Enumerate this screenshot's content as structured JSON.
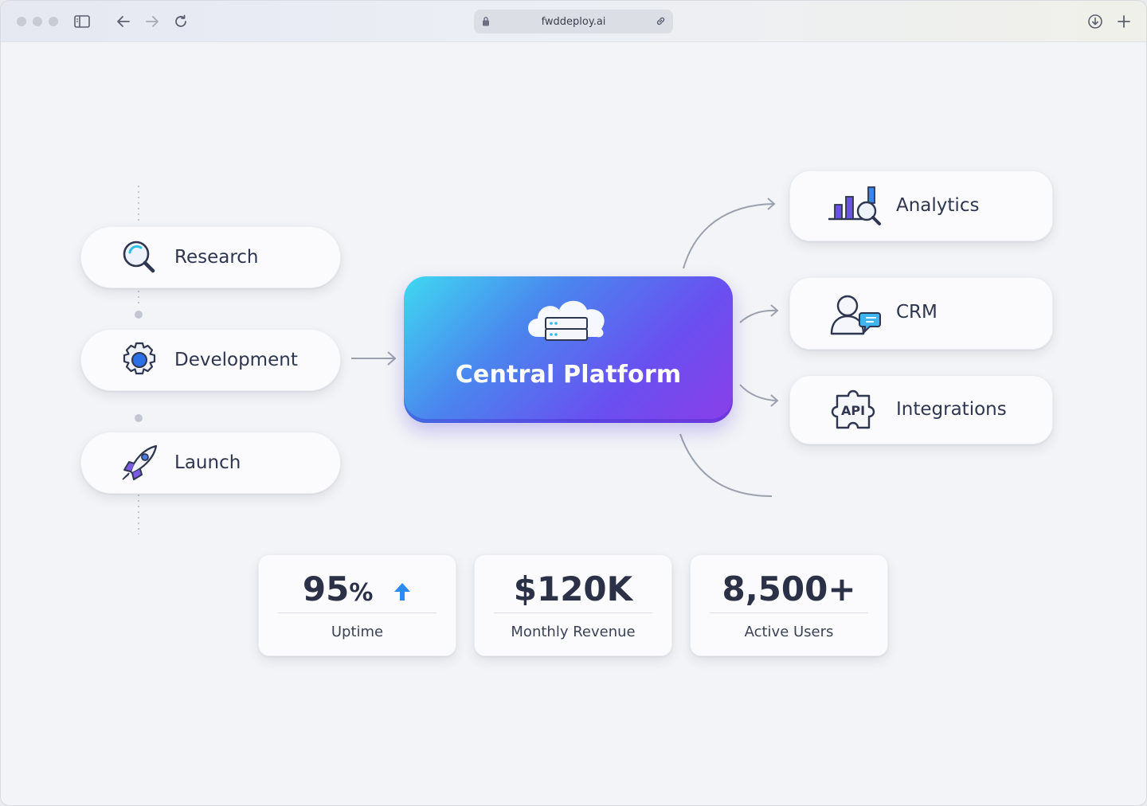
{
  "browser": {
    "url": "fwddeploy.ai"
  },
  "stages": [
    {
      "label": "Research",
      "icon": "magnifier-icon"
    },
    {
      "label": "Development",
      "icon": "gear-icon"
    },
    {
      "label": "Launch",
      "icon": "rocket-icon"
    }
  ],
  "central": {
    "title": "Central Platform",
    "icon": "cloud-server-icon"
  },
  "services": [
    {
      "label": "Analytics",
      "icon": "bar-chart-magnifier-icon"
    },
    {
      "label": "CRM",
      "icon": "user-chat-icon"
    },
    {
      "label": "Integrations",
      "icon": "api-puzzle-icon",
      "icon_text": "API"
    }
  ],
  "stats": [
    {
      "value": "95",
      "unit": "%",
      "label": "Uptime",
      "trend": "up-arrow-icon"
    },
    {
      "value": "$120K",
      "label": "Monthly Revenue"
    },
    {
      "value": "8,500+",
      "label": "Active Users"
    }
  ],
  "colors": {
    "gradient_start": "#3fd9f0",
    "gradient_end": "#8a3fe8",
    "text_dark": "#2b3247",
    "accent_blue": "#2a8bf2"
  }
}
